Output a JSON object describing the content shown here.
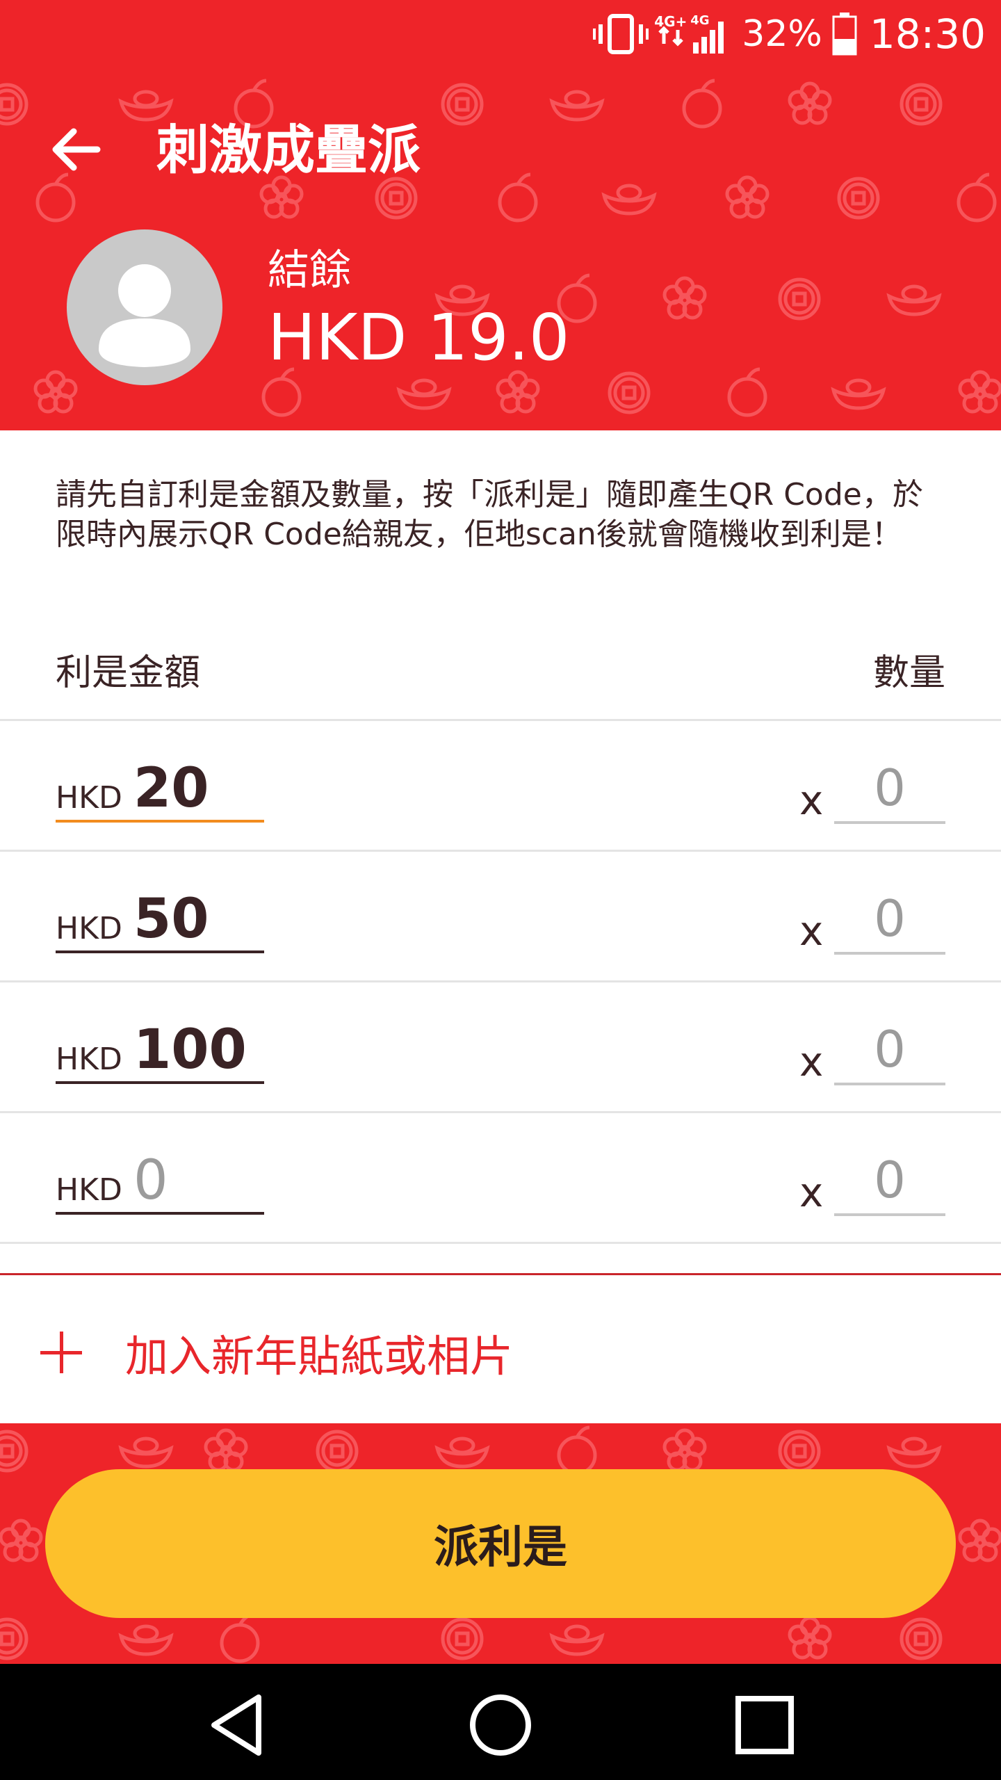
{
  "status_bar": {
    "network_label": "4G+",
    "network_label_2": "4G",
    "battery_percent": "32%",
    "time": "18:30"
  },
  "app_bar": {
    "title": "刺激成疊派"
  },
  "balance": {
    "label": "結餘",
    "value": "HKD 19.0"
  },
  "instructions": "請先自訂利是金額及數量，按「派利是」隨即產生QR Code，於限時內展示QR Code給親友，佢地scan後就會隨機收到利是！",
  "columns": {
    "amount": "利是金額",
    "quantity": "數量"
  },
  "rows": [
    {
      "currency": "HKD",
      "amount": "20",
      "times": "x",
      "quantity": "0"
    },
    {
      "currency": "HKD",
      "amount": "50",
      "times": "x",
      "quantity": "0"
    },
    {
      "currency": "HKD",
      "amount": "100",
      "times": "x",
      "quantity": "0"
    },
    {
      "currency": "HKD",
      "amount": "0",
      "times": "x",
      "quantity": "0"
    }
  ],
  "add_sticker": {
    "icon": "plus-icon",
    "label": "加入新年貼紙或相片"
  },
  "send_button": {
    "label": "派利是"
  },
  "colors": {
    "header_red": "#ee2429",
    "button_yellow": "#fdc02b",
    "accent_orange": "#f28c1e",
    "text_dark": "#3a2325"
  },
  "nav_bar": {
    "back_icon": "triangle-back-icon",
    "home_icon": "circle-home-icon",
    "recents_icon": "square-recents-icon"
  }
}
